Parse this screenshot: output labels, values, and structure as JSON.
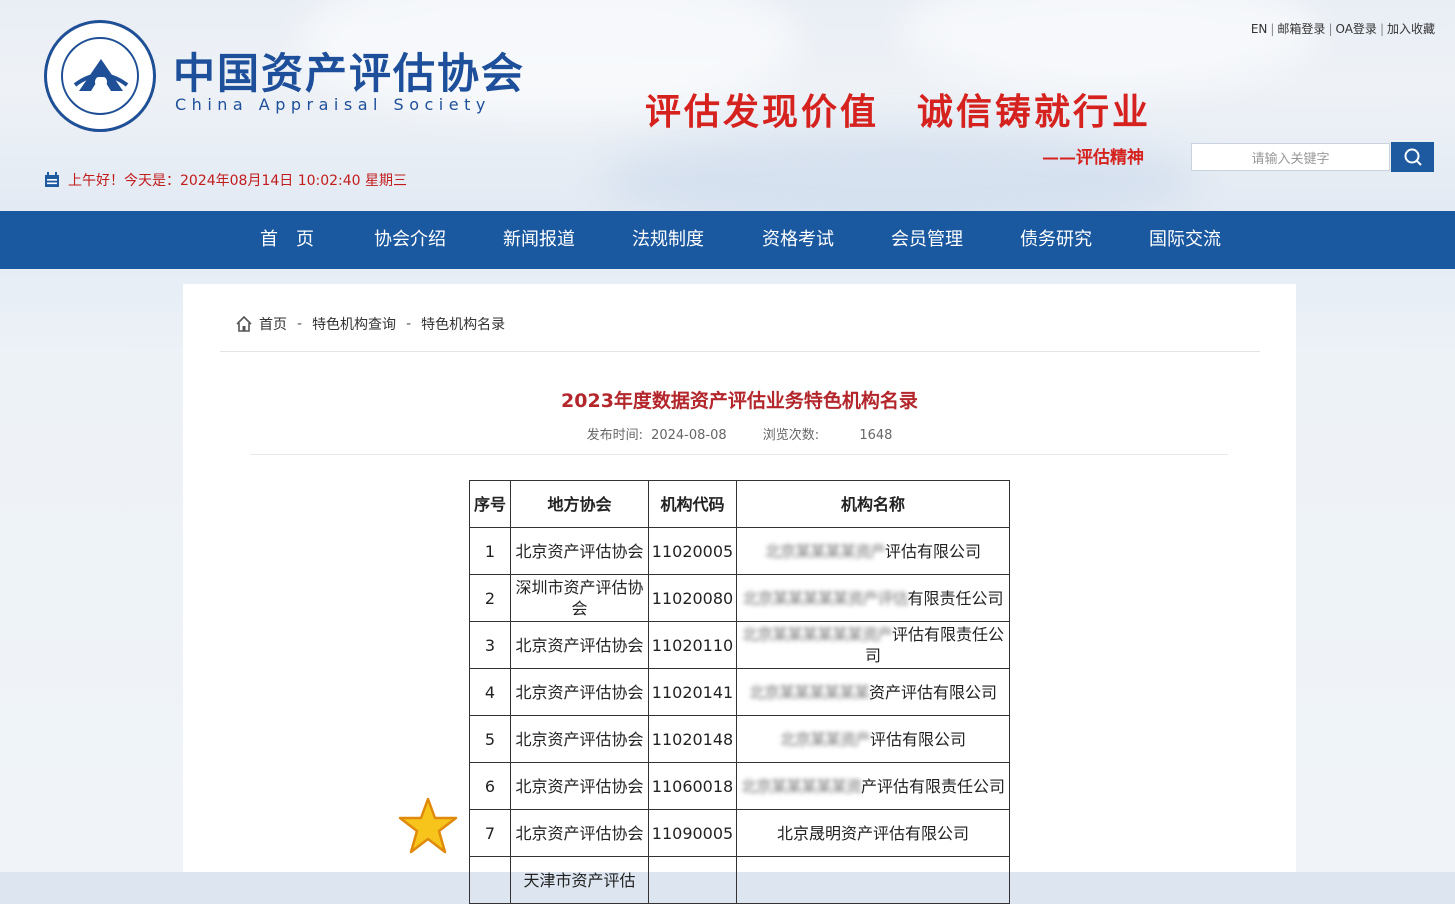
{
  "header": {
    "logo_cn": "中国资产评估协会",
    "logo_en": "China Appraisal Society",
    "top_links": [
      "EN",
      "邮箱登录",
      "OA登录",
      "加入收藏"
    ],
    "slogan_left": "评估发现价值",
    "slogan_right": "诚信铸就行业",
    "slogan_sub": "——评估精神",
    "search_placeholder": "请输入关键字",
    "greeting": "上午好！今天是：2024年08月14日 10:02:40 星期三"
  },
  "nav": [
    "首　页",
    "协会介绍",
    "新闻报道",
    "法规制度",
    "资格考试",
    "会员管理",
    "债务研究",
    "国际交流"
  ],
  "breadcrumb": [
    "首页",
    "特色机构查询",
    "特色机构名录"
  ],
  "article": {
    "title": "2023年度数据资产评估业务特色机构名录",
    "publish_label": "发布时间:",
    "publish_date": "2024-08-08",
    "views_label": "浏览次数:",
    "views": "1648"
  },
  "table": {
    "headers": [
      "序号",
      "地方协会",
      "机构代码",
      "机构名称"
    ],
    "rows": [
      {
        "no": "1",
        "assoc": "北京资产评估协会",
        "code": "11020005",
        "name_hidden": "北京某某某某资产",
        "name_visible": "评估有限公司"
      },
      {
        "no": "2",
        "assoc": "深圳市资产评估协会",
        "code": "11020080",
        "name_hidden": "北京某某某某某资产评估",
        "name_visible": "有限责任公司"
      },
      {
        "no": "3",
        "assoc": "北京资产评估协会",
        "code": "11020110",
        "name_hidden": "北京某某某某某某资产",
        "name_visible": "评估有限责任公司"
      },
      {
        "no": "4",
        "assoc": "北京资产评估协会",
        "code": "11020141",
        "name_hidden": "北京某某某某某某",
        "name_visible": "资产评估有限公司"
      },
      {
        "no": "5",
        "assoc": "北京资产评估协会",
        "code": "11020148",
        "name_hidden": "北京某某资产",
        "name_visible": "评估有限公司"
      },
      {
        "no": "6",
        "assoc": "北京资产评估协会",
        "code": "11060018",
        "name_hidden": "北京某某某某某资",
        "name_visible": "产评估有限责任公司"
      },
      {
        "no": "7",
        "assoc": "北京资产评估协会",
        "code": "11090005",
        "name_hidden": "",
        "name_visible": "北京晟明资产评估有限公司"
      },
      {
        "no": "",
        "assoc": "天津市资产评估",
        "code": "",
        "name_hidden": "",
        "name_visible": ""
      }
    ]
  }
}
